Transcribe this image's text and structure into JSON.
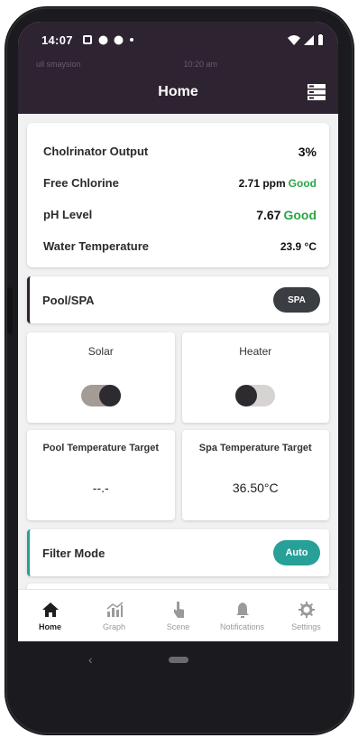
{
  "status": {
    "time": "14:07",
    "faint_left": "ull smaysion",
    "faint_center": "10:20 am"
  },
  "app": {
    "title": "Home"
  },
  "readings": [
    {
      "label": "Cholrinator Output",
      "value": "3%",
      "status": ""
    },
    {
      "label": "Free Chlorine",
      "value": "2.71 ppm",
      "status": "Good"
    },
    {
      "label": "pH Level",
      "value": "7.67",
      "status": "Good"
    },
    {
      "label": "Water Temperature",
      "value": "23.9 °C",
      "status": ""
    }
  ],
  "pool_spa": {
    "label": "Pool/SPA",
    "button": "SPA"
  },
  "solar": {
    "label": "Solar",
    "on": true
  },
  "heater": {
    "label": "Heater",
    "on": false
  },
  "pool_target": {
    "label": "Pool Temperature Target",
    "value": "--.-"
  },
  "spa_target": {
    "label": "Spa Temperature Target",
    "value": "36.50°C"
  },
  "filter": {
    "label": "Filter Mode",
    "button": "Auto"
  },
  "nav": [
    {
      "label": "Home",
      "icon": "home-icon"
    },
    {
      "label": "Graph",
      "icon": "graph-icon"
    },
    {
      "label": "Scene",
      "icon": "scene-icon"
    },
    {
      "label": "Notifications",
      "icon": "bell-icon"
    },
    {
      "label": "Settings",
      "icon": "gear-icon"
    }
  ],
  "colors": {
    "header": "#2d2331",
    "good": "#27a745",
    "teal": "#27a098",
    "dark_pill": "#3a3d42"
  }
}
